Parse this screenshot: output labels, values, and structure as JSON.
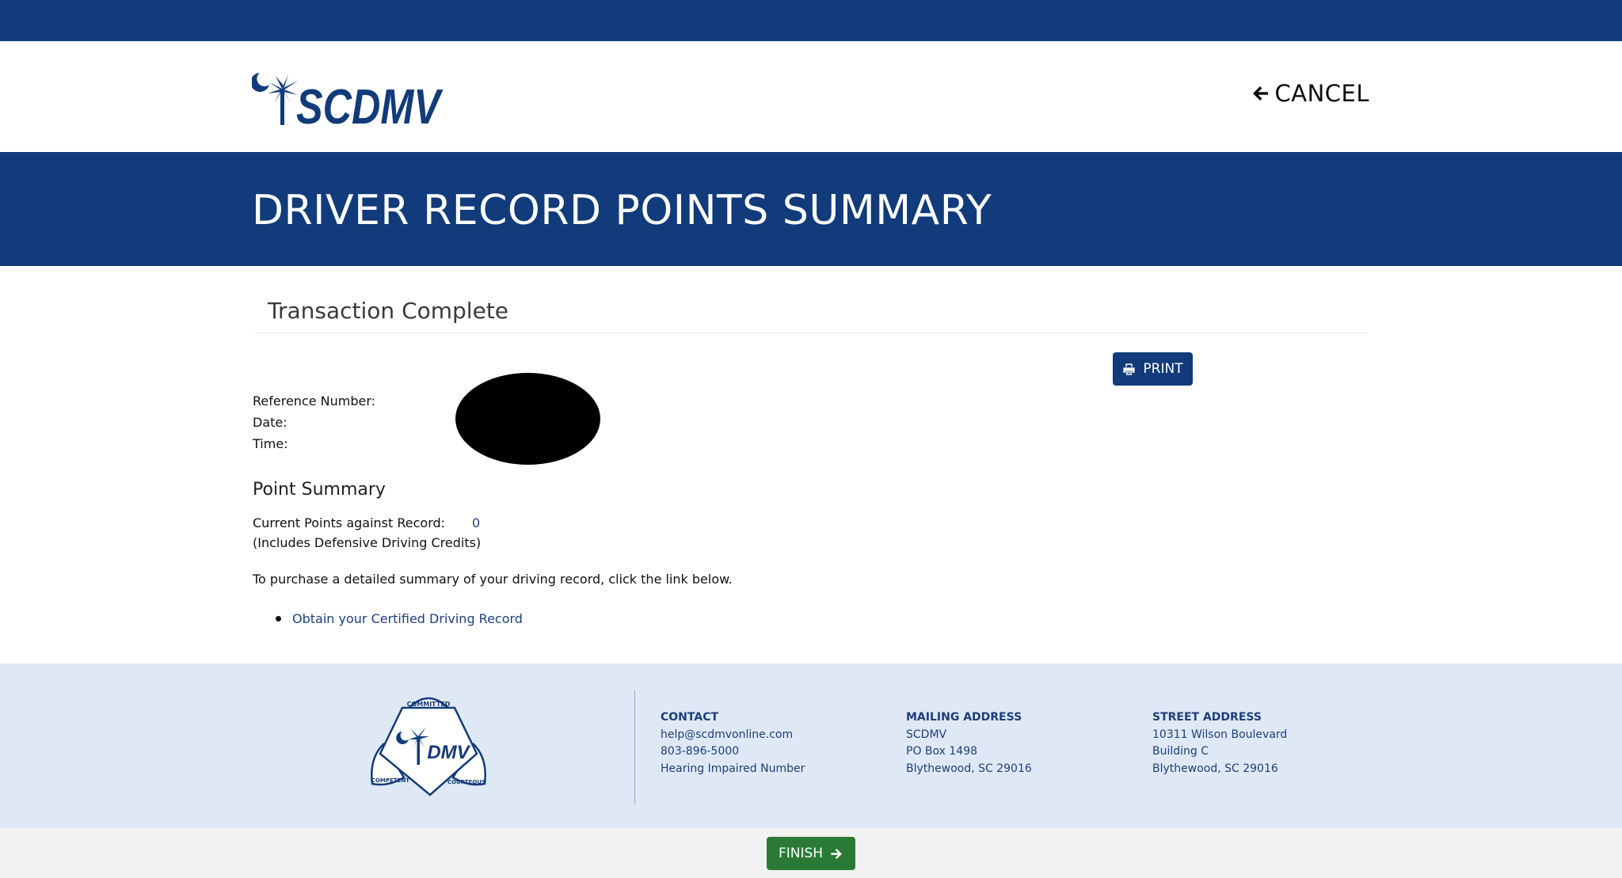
{
  "header": {
    "logo_text": "SCDMV",
    "cancel_label": "CANCEL"
  },
  "banner": {
    "title": "DRIVER RECORD POINTS SUMMARY"
  },
  "transaction": {
    "title": "Transaction Complete",
    "print_label": "PRINT",
    "reference_label": "Reference Number:",
    "date_label": "Date:",
    "time_label": "Time:"
  },
  "points": {
    "title": "Point Summary",
    "current_label": "Current Points against Record:",
    "note": "(Includes Defensive Driving Credits)",
    "value": "0"
  },
  "purchase": {
    "text": "To purchase a detailed summary of your driving record, click the link below.",
    "link_label": "Obtain your Certified Driving Record"
  },
  "footer": {
    "badge": {
      "top": "COMMITTED",
      "left": "COMPETENT",
      "right": "COURTEOUS",
      "center": "DMV"
    },
    "contact": {
      "heading": "CONTACT",
      "email": "help@scdmvonline.com",
      "phone": "803-896-5000",
      "hearing": "Hearing Impaired Number"
    },
    "mailing": {
      "heading": "MAILING ADDRESS",
      "line1": "SCDMV",
      "line2": "PO Box 1498",
      "line3": "Blythewood, SC 29016"
    },
    "street": {
      "heading": "STREET ADDRESS",
      "line1": "10311 Wilson Boulevard",
      "line2": "Building C",
      "line3": "Blythewood, SC 29016"
    }
  },
  "actions": {
    "finish_label": "FINISH"
  },
  "colors": {
    "primary": "#113b7a",
    "footer_bg": "#dfe9f6",
    "finish": "#2a7a35",
    "link": "#1d3f7a"
  }
}
